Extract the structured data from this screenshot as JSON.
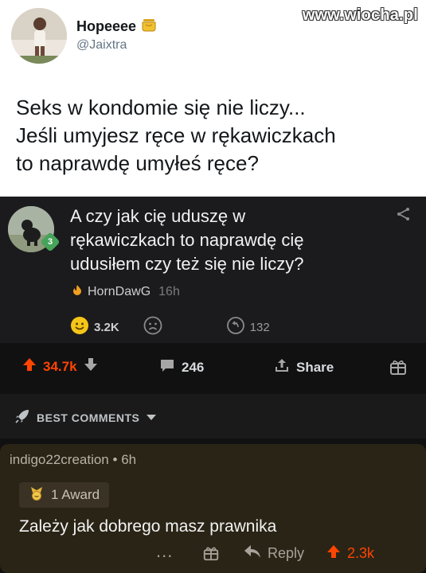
{
  "tweet": {
    "name": "Hopeeee",
    "handle": "@Jaixtra",
    "watermark": "www.wiocha.pl",
    "lines": [
      "Seks w kondomie się nie liczy...",
      "Jeśli umyjesz ręce w rękawiczkach",
      "to naprawdę umyłeś ręce?"
    ]
  },
  "card": {
    "badge": "3",
    "lines": [
      "A czy jak cię uduszę w",
      "rękawiczkach to naprawdę cię",
      "udusiłem czy też się nie liczy?"
    ],
    "author": "HornDawG",
    "time": "16h",
    "reactions": {
      "happy_count": "3.2K",
      "comments_count": "132"
    }
  },
  "actions": {
    "upvotes": "34.7k",
    "comments": "246",
    "share": "Share"
  },
  "sort": {
    "label": "BEST COMMENTS"
  },
  "comment": {
    "user": "indigo22creation",
    "separator": "•",
    "time": "6h",
    "award": "1 Award",
    "body": "Zależy jak dobrego masz prawnika",
    "more": "...",
    "reply": "Reply",
    "upvotes": "2.3k"
  }
}
